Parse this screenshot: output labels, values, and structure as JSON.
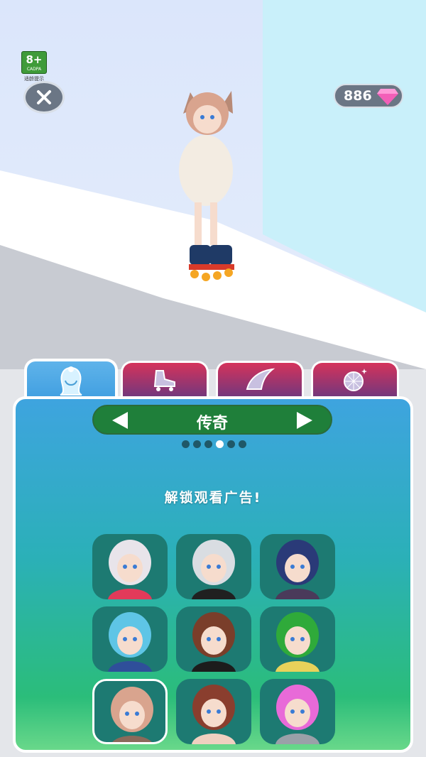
{
  "rating": {
    "age": "8+",
    "org": "CADPA",
    "tip": "适龄提示"
  },
  "hud": {
    "gems": "886"
  },
  "tabs": [
    {
      "id": "hair",
      "icon": "hair-icon",
      "active": true
    },
    {
      "id": "skates",
      "icon": "roller-skate-icon",
      "active": false
    },
    {
      "id": "wings",
      "icon": "wing-icon",
      "active": false
    },
    {
      "id": "disco",
      "icon": "disco-ball-icon",
      "active": false
    }
  ],
  "category": {
    "name": "传奇",
    "page_index": 4,
    "page_count": 6
  },
  "unlock_text": "解锁观看广告!",
  "characters": [
    {
      "id": "ram-skull",
      "hair": "#e8e4ea",
      "accent": "#e23a5a",
      "selected": false
    },
    {
      "id": "silver-hair",
      "hair": "#d9dde2",
      "accent": "#202020",
      "selected": false
    },
    {
      "id": "blue-cat",
      "hair": "#2a3a78",
      "accent": "#4a3a5a",
      "selected": false
    },
    {
      "id": "teal-hat",
      "hair": "#5ec5e6",
      "accent": "#2f4f9a",
      "selected": false
    },
    {
      "id": "brown-curly",
      "hair": "#7a3e2a",
      "accent": "#1c1c1c",
      "selected": false
    },
    {
      "id": "frog-hood",
      "hair": "#2faa3a",
      "accent": "#e8d25a",
      "selected": false
    },
    {
      "id": "pink-cat",
      "hair": "#d9a48e",
      "accent": "#8a6a5a",
      "selected": true
    },
    {
      "id": "auburn",
      "hair": "#8a3e2e",
      "accent": "#f0d0c0",
      "selected": false
    },
    {
      "id": "pink-robot",
      "hair": "#e86ad8",
      "accent": "#9aa0a8",
      "selected": false
    }
  ],
  "colors": {
    "panel_top": "#3ea4df",
    "panel_bottom": "#69d88a",
    "tab_inactive": "#d5335b",
    "category_bg": "#1f7f3a"
  }
}
